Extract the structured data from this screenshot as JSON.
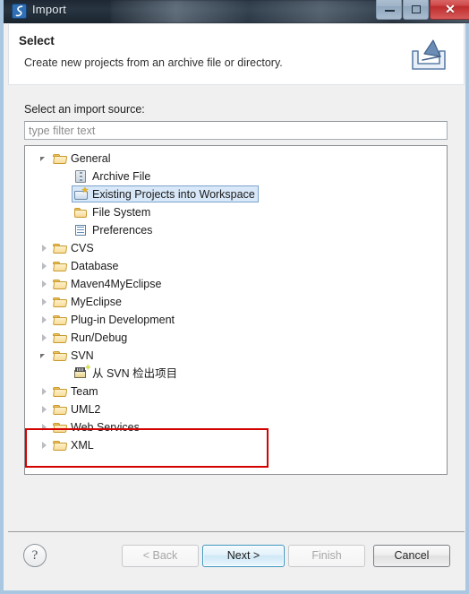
{
  "window": {
    "title": "Import",
    "app_icon": "eclipse-import-icon",
    "controls": {
      "minimize": "minimize-icon",
      "maximize": "maximize-icon",
      "close": "✕"
    }
  },
  "banner": {
    "title": "Select",
    "description": "Create new projects from an archive file or directory.",
    "icon": "import-arrow-icon"
  },
  "main": {
    "source_label": "Select an import source:",
    "filter": {
      "placeholder": "type filter text",
      "value": ""
    },
    "tree": [
      {
        "label": "General",
        "level": 0,
        "state": "expanded",
        "icon": "folder-open-icon",
        "selected": false
      },
      {
        "label": "Archive File",
        "level": 1,
        "state": "leaf",
        "icon": "archive-file-icon",
        "selected": false
      },
      {
        "label": "Existing Projects into Workspace",
        "level": 1,
        "state": "leaf",
        "icon": "project-folder-icon",
        "selected": true
      },
      {
        "label": "File System",
        "level": 1,
        "state": "leaf",
        "icon": "folder-closed-icon",
        "selected": false
      },
      {
        "label": "Preferences",
        "level": 1,
        "state": "leaf",
        "icon": "preferences-icon",
        "selected": false
      },
      {
        "label": "CVS",
        "level": 0,
        "state": "collapsed",
        "icon": "folder-open-icon",
        "selected": false
      },
      {
        "label": "Database",
        "level": 0,
        "state": "collapsed",
        "icon": "folder-open-icon",
        "selected": false
      },
      {
        "label": "Maven4MyEclipse",
        "level": 0,
        "state": "collapsed",
        "icon": "folder-open-icon",
        "selected": false
      },
      {
        "label": "MyEclipse",
        "level": 0,
        "state": "collapsed",
        "icon": "folder-open-icon",
        "selected": false
      },
      {
        "label": "Plug-in Development",
        "level": 0,
        "state": "collapsed",
        "icon": "folder-open-icon",
        "selected": false
      },
      {
        "label": "Run/Debug",
        "level": 0,
        "state": "collapsed",
        "icon": "folder-open-icon",
        "selected": false
      },
      {
        "label": "SVN",
        "level": 0,
        "state": "expanded",
        "icon": "folder-open-icon",
        "selected": false
      },
      {
        "label": "从 SVN 检出项目",
        "level": 1,
        "state": "leaf",
        "icon": "svn-checkout-icon",
        "selected": false
      },
      {
        "label": "Team",
        "level": 0,
        "state": "collapsed",
        "icon": "folder-open-icon",
        "selected": false
      },
      {
        "label": "UML2",
        "level": 0,
        "state": "collapsed",
        "icon": "folder-open-icon",
        "selected": false
      },
      {
        "label": "Web Services",
        "level": 0,
        "state": "collapsed",
        "icon": "folder-open-icon",
        "selected": false
      },
      {
        "label": "XML",
        "level": 0,
        "state": "collapsed",
        "icon": "folder-open-icon",
        "selected": false
      }
    ],
    "annotation": {
      "type": "red-rectangle-highlight",
      "color": "#d40000",
      "targets": [
        "SVN",
        "从 SVN 检出项目"
      ]
    }
  },
  "footer": {
    "help_label": "?",
    "buttons": [
      {
        "id": "back",
        "label": "< Back",
        "state": "disabled"
      },
      {
        "id": "next",
        "label": "Next >",
        "state": "default"
      },
      {
        "id": "finish",
        "label": "Finish",
        "state": "disabled"
      },
      {
        "id": "cancel",
        "label": "Cancel",
        "state": "normal"
      }
    ]
  },
  "colors": {
    "selection_fill": "#d8e8f8",
    "selection_border": "#7da2ce",
    "annotation": "#d40000",
    "dialog_bg": "#f0f0f0",
    "frame": "#aac7e2"
  }
}
